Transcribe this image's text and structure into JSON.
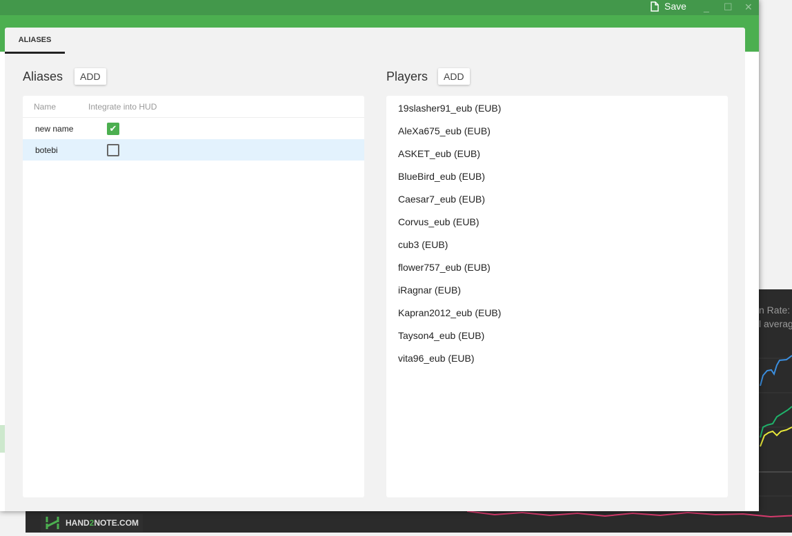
{
  "titlebar": {
    "save_label": "Save",
    "minimize": "_",
    "maximize": "☐",
    "close": "✕"
  },
  "tabs": [
    {
      "label": "ALIASES",
      "active": true
    }
  ],
  "aliases": {
    "title": "Aliases",
    "add_label": "ADD",
    "columns": [
      "Name",
      "Integrate into HUD"
    ],
    "rows": [
      {
        "name": "new name",
        "integrate": true,
        "selected": false
      },
      {
        "name": "botebi",
        "integrate": false,
        "selected": true
      }
    ]
  },
  "players": {
    "title": "Players",
    "add_label": "ADD",
    "items": [
      "19slasher91_eub (EUB)",
      "AleXa675_eub (EUB)",
      "ASKET_eub (EUB)",
      "BlueBird_eub (EUB)",
      "Caesar7_eub (EUB)",
      "Corvus_eub (EUB)",
      "cub3 (EUB)",
      "flower757_eub (EUB)",
      "iRagnar (EUB)",
      "Kapran2012_eub (EUB)",
      "Tayson4_eub (EUB)",
      "vita96_eub (EUB)"
    ]
  },
  "background": {
    "chart_text_1": "n Rate:",
    "chart_text_2": "l averag",
    "logo": "HAND2NOTE.COM",
    "line_colors": [
      "#3b8fe0",
      "#1fb36b",
      "#e8e83a",
      "#d83b6e"
    ]
  }
}
